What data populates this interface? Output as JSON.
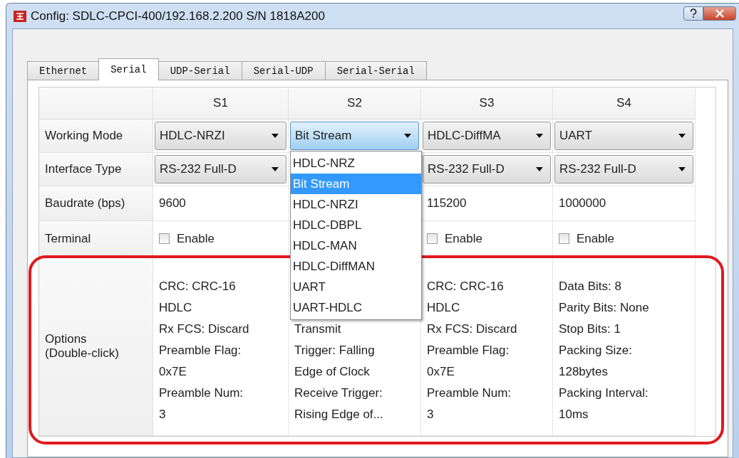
{
  "window": {
    "title": "Config: SDLC-CPCI-400/192.168.2.200 S/N 1818A200"
  },
  "tabs": [
    {
      "label": "Ethernet",
      "selected": false
    },
    {
      "label": "Serial",
      "selected": true
    },
    {
      "label": "UDP-Serial",
      "selected": false
    },
    {
      "label": "Serial-UDP",
      "selected": false
    },
    {
      "label": "Serial-Serial",
      "selected": false
    }
  ],
  "table": {
    "columns": [
      "S1",
      "S2",
      "S3",
      "S4"
    ],
    "rows": [
      {
        "kind": "dropdown",
        "label": "Working Mode",
        "cells": [
          {
            "value": "HDLC-NRZI",
            "open": false
          },
          {
            "value": "Bit Stream",
            "open": true,
            "options": [
              {
                "label": "HDLC-NRZ",
                "selected": false
              },
              {
                "label": "Bit Stream",
                "selected": true
              },
              {
                "label": "HDLC-NRZI",
                "selected": false
              },
              {
                "label": "HDLC-DBPL",
                "selected": false
              },
              {
                "label": "HDLC-MAN",
                "selected": false
              },
              {
                "label": "HDLC-DiffMAN",
                "selected": false
              },
              {
                "label": "UART",
                "selected": false
              },
              {
                "label": "UART-HDLC",
                "selected": false
              }
            ]
          },
          {
            "value": "HDLC-DiffMA",
            "open": false
          },
          {
            "value": "UART",
            "open": false
          }
        ]
      },
      {
        "kind": "dropdown",
        "label": "Interface Type",
        "cells": [
          {
            "value": "RS-232 Full-D",
            "open": false
          },
          null,
          {
            "value": "RS-232 Full-D",
            "open": false
          },
          {
            "value": "RS-232 Full-D",
            "open": false
          }
        ]
      },
      {
        "kind": "text",
        "label": "Baudrate (bps)",
        "cells": [
          {
            "value": "9600"
          },
          null,
          {
            "value": "115200"
          },
          {
            "value": "1000000"
          }
        ]
      },
      {
        "kind": "checkbox",
        "label": "Terminal",
        "cells": [
          {
            "label": "Enable",
            "checked": false
          },
          null,
          {
            "label": "Enable",
            "checked": false
          },
          {
            "label": "Enable",
            "checked": false
          }
        ]
      },
      {
        "kind": "options",
        "label": "Options\n(Double-click)",
        "highlighted": true,
        "cells": [
          {
            "lines": [
              "CRC: CRC-16",
              "HDLC",
              "Rx FCS: Discard",
              "Preamble Flag:",
              "0x7E",
              "Preamble Num:",
              "3"
            ]
          },
          {
            "lines": [
              "Transmit",
              "Trigger: Falling",
              "Edge of Clock",
              "Receive Trigger:",
              "Rising Edge of..."
            ]
          },
          {
            "lines": [
              "CRC: CRC-16",
              "HDLC",
              "Rx FCS: Discard",
              "Preamble Flag:",
              "0x7E",
              "Preamble Num:",
              "3"
            ]
          },
          {
            "lines": [
              "Data Bits: 8",
              "Parity Bits: None",
              "Stop Bits: 1",
              "Packing Size:",
              "128bytes",
              "Packing Interval:",
              "10ms"
            ]
          }
        ]
      }
    ]
  }
}
